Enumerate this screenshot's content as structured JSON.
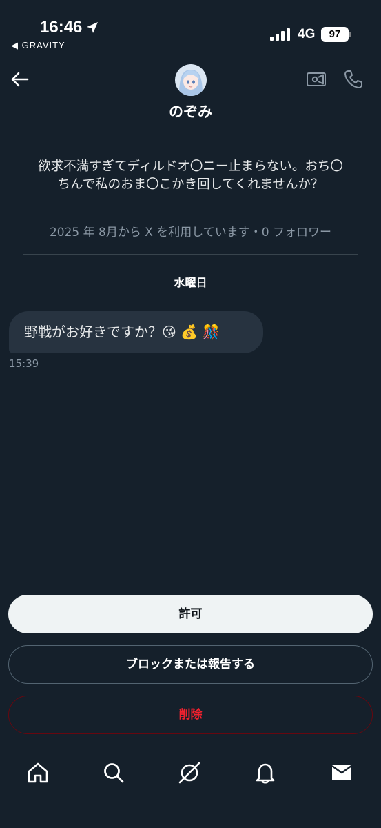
{
  "status_bar": {
    "time": "16:46",
    "back_app": "◀ GRAVITY",
    "network": "4G",
    "battery": "97"
  },
  "header": {
    "display_name": "のぞみ"
  },
  "profile": {
    "bio": "欲求不満すぎてディルドオ〇ニー止まらない。おち〇ちんで私のおま〇こかき回してくれませんか？",
    "joined": "2025 年 8月から X を利用しています・0 フォロワー"
  },
  "conversation": {
    "day_label": "水曜日",
    "messages": [
      {
        "text": "野戦がお好きですか？😘 💰 🎊",
        "time": "15:39"
      }
    ]
  },
  "actions": {
    "allow": "許可",
    "block_or_report": "ブロックまたは報告する",
    "delete": "削除"
  },
  "nav": {
    "items": [
      "home-icon",
      "search-icon",
      "grok-icon",
      "notifications-icon",
      "messages-icon"
    ]
  },
  "colors": {
    "background": "#15202b",
    "bubble": "#273340",
    "muted_text": "#8b98a5",
    "delete_red": "#f4212e"
  }
}
